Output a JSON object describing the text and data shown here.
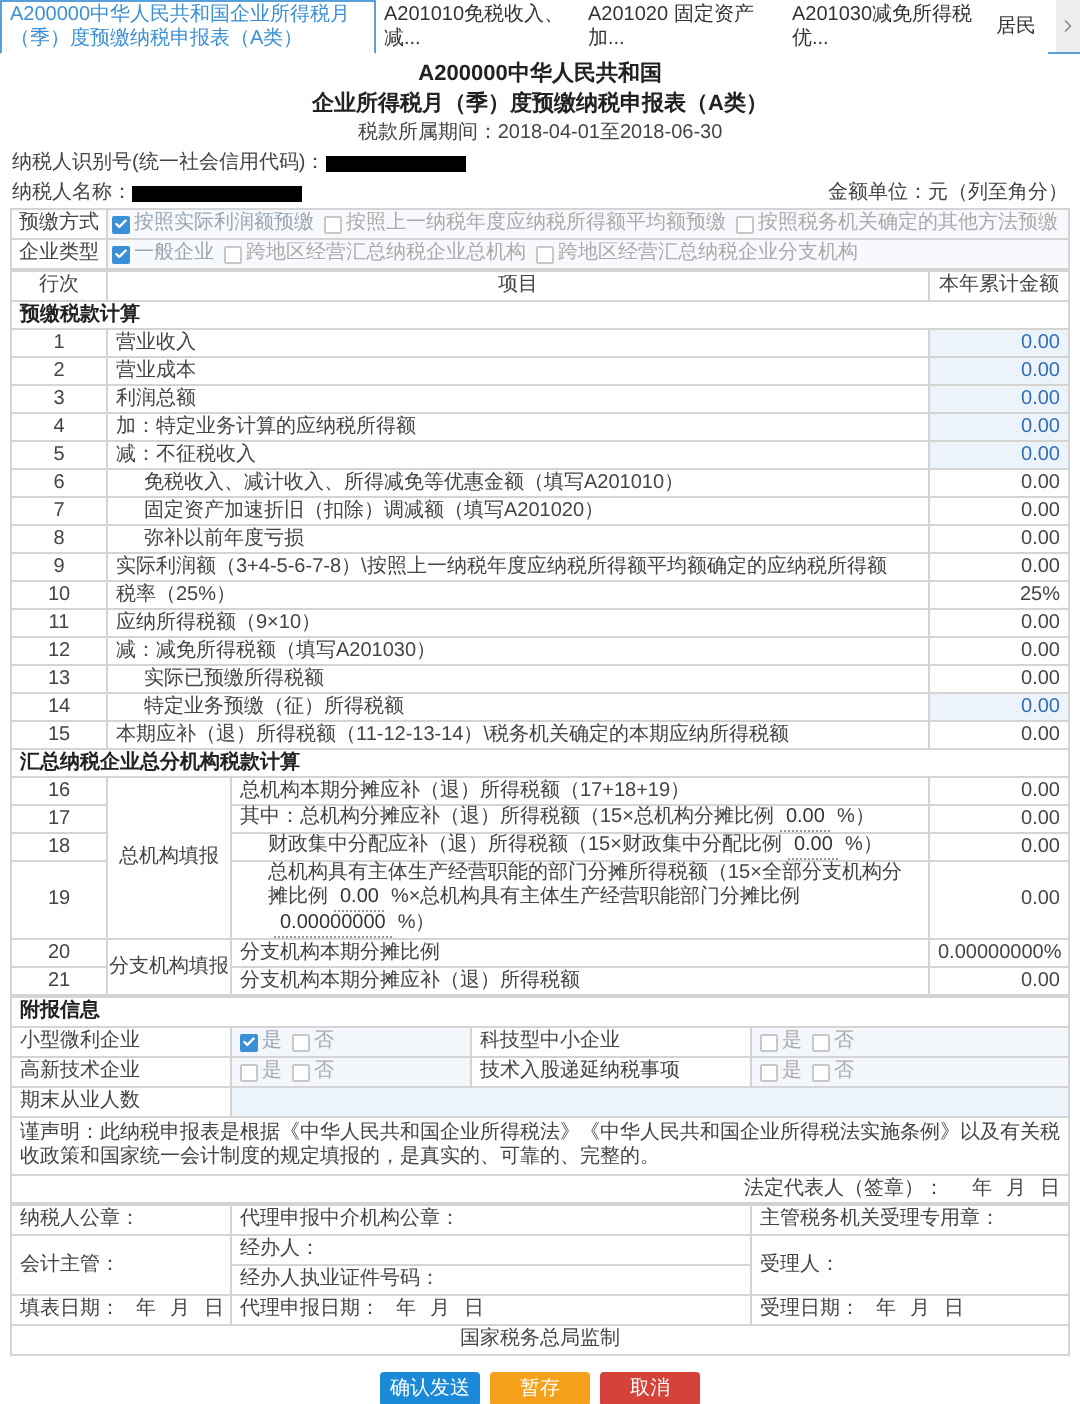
{
  "tabs": [
    {
      "label": "A200000中华人民共和国企业所得税月（季）度预缴纳税申报表（A类）",
      "selected": true
    },
    {
      "label": "A201010免税收入、减...",
      "selected": false
    },
    {
      "label": "A201020 固定资产加...",
      "selected": false
    },
    {
      "label": "A201030减免所得税优...",
      "selected": false
    },
    {
      "label": "居民",
      "selected": false
    }
  ],
  "title_lines": [
    "A200000中华人民共和国",
    "企业所得税月（季）度预缴纳税申报表（A类）"
  ],
  "period": "税款所属期间：2018-04-01至2018-06-30",
  "taxpayer_id_label": "纳税人识别号(统一社会信用代码)：",
  "taxpayer_name_label": "纳税人名称：",
  "amount_unit": "金额单位：元（列至角分）",
  "options": [
    {
      "label": "预缴方式",
      "choices": [
        {
          "label": "按照实际利润额预缴",
          "checked": true
        },
        {
          "label": "按照上一纳税年度应纳税所得额平均额预缴",
          "checked": false
        },
        {
          "label": "按照税务机关确定的其他方法预缴",
          "checked": false
        }
      ]
    },
    {
      "label": "企业类型",
      "choices": [
        {
          "label": "一般企业",
          "checked": true
        },
        {
          "label": "跨地区经营汇总纳税企业总机构",
          "checked": false
        },
        {
          "label": "跨地区经营汇总纳税企业分支机构",
          "checked": false
        }
      ]
    }
  ],
  "columns": [
    "行次",
    "项目",
    "本年累计金额"
  ],
  "calculation": {
    "title": "预缴税款计算",
    "rows": [
      {
        "line": "1",
        "kind": "main",
        "item": "营业收入",
        "amount": "0.00",
        "editable": true
      },
      {
        "line": "2",
        "kind": "main",
        "item": "营业成本",
        "amount": "0.00",
        "editable": true
      },
      {
        "line": "3",
        "kind": "main",
        "item": "利润总额",
        "amount": "0.00",
        "editable": true
      },
      {
        "line": "4",
        "kind": "main",
        "item": "加：特定业务计算的应纳税所得额",
        "amount": "0.00",
        "editable": true
      },
      {
        "line": "5",
        "kind": "main",
        "item": "减：不征税收入",
        "amount": "0.00",
        "editable": true
      },
      {
        "line": "6",
        "kind": "sub",
        "item": "免税收入、减计收入、所得减免等优惠金额（填写A201010）",
        "amount": "0.00",
        "editable": false
      },
      {
        "line": "7",
        "kind": "sub",
        "item": "固定资产加速折旧（扣除）调减额（填写A201020）",
        "amount": "0.00",
        "editable": false
      },
      {
        "line": "8",
        "kind": "sub",
        "item": "弥补以前年度亏损",
        "amount": "0.00",
        "editable": false
      },
      {
        "line": "9",
        "kind": "main",
        "item": "实际利润额（3+4-5-6-7-8）\\按照上一纳税年度应纳税所得额平均额确定的应纳税所得额",
        "amount": "0.00",
        "editable": false
      },
      {
        "line": "10",
        "kind": "main",
        "item": "税率（25%）",
        "amount": "25%",
        "editable": false
      },
      {
        "line": "11",
        "kind": "main",
        "item": "应纳所得税额（9×10）",
        "amount": "0.00",
        "editable": false
      },
      {
        "line": "12",
        "kind": "main",
        "item": "减：减免所得税额（填写A201030）",
        "amount": "0.00",
        "editable": false
      },
      {
        "line": "13",
        "kind": "sub",
        "item": "实际已预缴所得税额",
        "amount": "0.00",
        "editable": false
      },
      {
        "line": "14",
        "kind": "sub",
        "item": "特定业务预缴（征）所得税额",
        "amount": "0.00",
        "editable": true
      },
      {
        "line": "15",
        "kind": "main",
        "item": "本期应补（退）所得税额（11-12-13-14）\\税务机关确定的本期应纳所得税额",
        "amount": "0.00",
        "editable": false
      }
    ]
  },
  "consolidated": {
    "title": "汇总纳税企业总分机构税款计算",
    "groups": [
      {
        "label": "总机构填报",
        "rows": [
          {
            "line": "16",
            "kind": "main",
            "parts": [
              {
                "kind": "text",
                "text": "总机构本期分摊应补（退）所得税额（17+18+19）"
              }
            ],
            "amount": "0.00"
          },
          {
            "line": "17",
            "kind": "main",
            "parts": [
              {
                "kind": "text",
                "text": "其中：总机构分摊应补（退）所得税额（15×总机构分摊比例"
              },
              {
                "kind": "field",
                "text": "0.00"
              },
              {
                "kind": "text",
                "text": "%）"
              }
            ],
            "amount": "0.00"
          },
          {
            "line": "18",
            "kind": "sub",
            "parts": [
              {
                "kind": "text",
                "text": "财政集中分配应补（退）所得税额（15×财政集中分配比例"
              },
              {
                "kind": "field",
                "text": "0.00"
              },
              {
                "kind": "text",
                "text": "%）"
              }
            ],
            "amount": "0.00"
          },
          {
            "line": "19",
            "kind": "sub",
            "parts": [
              {
                "kind": "text",
                "text": "总机构具有主体生产经营职能的部门分摊所得税额（15×全部分支机构分摊比例"
              },
              {
                "kind": "field",
                "text": "0.00"
              },
              {
                "kind": "text",
                "text": "%×总机构具有主体生产经营职能部门分摊比例"
              },
              {
                "kind": "field",
                "text": "0.00000000"
              },
              {
                "kind": "text",
                "text": "%）"
              }
            ],
            "amount": "0.00"
          }
        ]
      },
      {
        "label": "分支机构填报",
        "rows": [
          {
            "line": "20",
            "kind": "main",
            "parts": [
              {
                "kind": "text",
                "text": "分支机构本期分摊比例"
              }
            ],
            "amount": "0.00000000%"
          },
          {
            "line": "21",
            "kind": "main",
            "parts": [
              {
                "kind": "text",
                "text": "分支机构本期分摊应补（退）所得税额"
              }
            ],
            "amount": "0.00"
          }
        ]
      }
    ]
  },
  "attachments": {
    "title": "附报信息",
    "rows": [
      [
        {
          "label": "小型微利企业",
          "choices": [
            {
              "label": "是",
              "checked": true
            },
            {
              "label": "否",
              "checked": false
            }
          ]
        },
        {
          "label": "科技型中小企业",
          "choices": [
            {
              "label": "是",
              "checked": false
            },
            {
              "label": "否",
              "checked": false
            }
          ]
        }
      ],
      [
        {
          "label": "高新技术企业",
          "choices": [
            {
              "label": "是",
              "checked": false
            },
            {
              "label": "否",
              "checked": false
            }
          ]
        },
        {
          "label": "技术入股递延纳税事项",
          "choices": [
            {
              "label": "是",
              "checked": false
            },
            {
              "label": "否",
              "checked": false
            }
          ]
        }
      ]
    ],
    "headcount_label": "期末从业人数"
  },
  "declaration": "谨声明：此纳税申报表是根据《中华人民共和国企业所得税法》《中华人民共和国企业所得税法实施条例》以及有关税收政策和国家统一会计制度的规定填报的，是真实的、可靠的、完整的。",
  "legal_rep": {
    "label": "法定代表人（签章）：",
    "date": [
      "年",
      "月",
      "日"
    ]
  },
  "signatures": {
    "taxpayer_seal": "纳税人公章：",
    "agency_seal": "代理申报中介机构公章：",
    "office_seal": "主管税务机关受理专用章：",
    "accountant": "会计主管：",
    "handler": "经办人：",
    "handler_id": "经办人执业证件号码：",
    "receiver": "受理人：",
    "dates": [
      {
        "label": "填表日期：",
        "date": [
          "年",
          "月",
          "日"
        ]
      },
      {
        "label": "代理申报日期：",
        "date": [
          "年",
          "月",
          "日"
        ]
      },
      {
        "label": "受理日期：",
        "date": [
          "年",
          "月",
          "日"
        ]
      }
    ]
  },
  "footer": "国家税务总局监制",
  "buttons": [
    {
      "label": "确认发送",
      "kind": "primary"
    },
    {
      "label": "暂存",
      "kind": "warning"
    },
    {
      "label": "取消",
      "kind": "danger"
    }
  ]
}
